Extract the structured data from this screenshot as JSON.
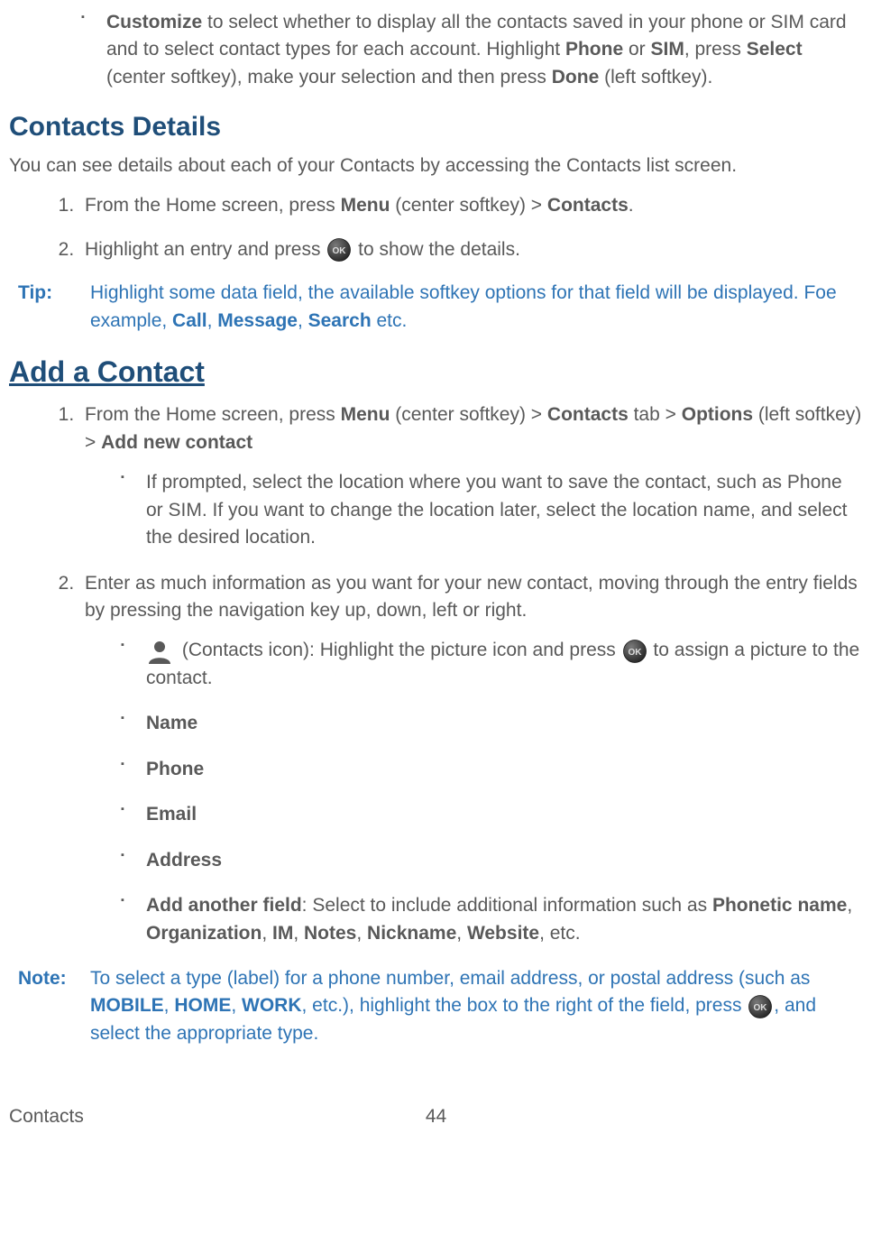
{
  "topbullet": {
    "lead": "Customize",
    "text_after_lead": " to select whether to display all the contacts saved in your phone or SIM card and to select contact types for each account. Highlight ",
    "phone": "Phone",
    "or": " or ",
    "sim": "SIM",
    "comma_press": ", press ",
    "select": "Select",
    "mid": " (center softkey), make your selection and then press ",
    "done": "Done",
    "tail": " (left softkey)."
  },
  "contacts_details": {
    "heading": "Contacts Details",
    "intro": "You can see details about each of your Contacts by accessing the Contacts list screen.",
    "steps": {
      "one": {
        "pre": "From the Home screen, press ",
        "menu": "Menu",
        "mid": " (center softkey) > ",
        "contacts": "Contacts",
        "post": "."
      },
      "two": {
        "pre": "Highlight an entry and press ",
        "post": " to show the details."
      }
    }
  },
  "tip": {
    "label": "Tip:",
    "pre": "Highlight some data field, the available softkey options for that field will be displayed. Foe example, ",
    "call": "Call",
    "c1": ", ",
    "message": "Message",
    "c2": ", ",
    "search": "Search",
    "post": " etc."
  },
  "add_contact": {
    "heading": "Add a Contact",
    "steps": {
      "one": {
        "pre": "From the Home screen, press ",
        "menu": "Menu",
        "mid1": " (center softkey) > ",
        "contacts": "Contacts",
        "mid2": " tab > ",
        "options": "Options",
        "mid3": " (left softkey) > ",
        "addnew": "Add new contact"
      },
      "one_sub": "If prompted, select the location where you want to save the contact, such as Phone or SIM. If you want to change the location later, select the location name, and select the desired location.",
      "two": "Enter as much information as you want for your new contact, moving through the entry fields by pressing the navigation key up, down, left or right.",
      "fields": {
        "contacts_icon": {
          "pre": " (Contacts icon): Highlight the picture icon and press ",
          "post": " to assign a picture to the contact."
        },
        "name": "Name",
        "phone": "Phone",
        "email": "Email",
        "address": "Address",
        "another": {
          "lead": "Add another field",
          "mid": ": Select to include additional information such as ",
          "phonetic": "Phonetic name",
          "c1": ", ",
          "org": "Organization",
          "c2": ", ",
          "im": "IM",
          "c3": ", ",
          "notes": "Notes",
          "c4": ", ",
          "nick": "Nickname",
          "c5": ", ",
          "web": "Website",
          "post": ", etc."
        }
      }
    }
  },
  "note": {
    "label": "Note:",
    "pre": "To select a type (label) for a phone number, email address, or postal address (such as ",
    "mobile": "MOBILE",
    "c1": ", ",
    "home": "HOME",
    "c2": ", ",
    "work": "WORK",
    "mid": ", etc.), highlight the box to the right of the field, press ",
    "post": ", and select the appropriate type."
  },
  "footer": {
    "section": "Contacts",
    "page": "44"
  }
}
